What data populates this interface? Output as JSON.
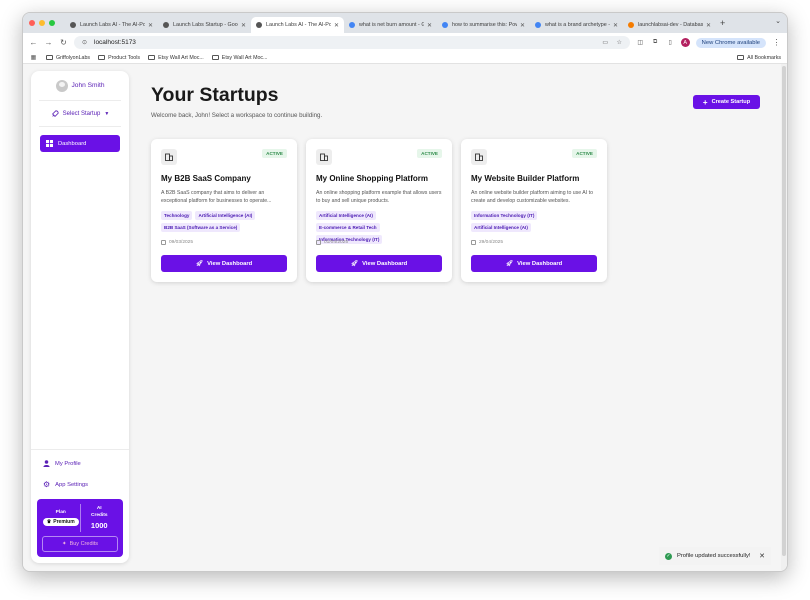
{
  "browser": {
    "tabs": [
      {
        "label": "Launch Labs AI - The AI-Pow",
        "fav_color": "#555555",
        "active": false
      },
      {
        "label": "Launch Labs Startup - Googl",
        "fav_color": "#555555",
        "active": false
      },
      {
        "label": "Launch Labs AI - The AI-Pow",
        "fav_color": "#555555",
        "active": true
      },
      {
        "label": "what is net burn amount - Go",
        "fav_color": "#4285f4",
        "active": false
      },
      {
        "label": "how to summarise this: Powe",
        "fav_color": "#4285f4",
        "active": false
      },
      {
        "label": "what is a brand archetype - G",
        "fav_color": "#4285f4",
        "active": false
      },
      {
        "label": "launchlabsai-dev - Database",
        "fav_color": "#f57c00",
        "active": false
      }
    ],
    "url": "localhost:5173",
    "new_chrome_label": "New Chrome available",
    "profile_initial": "A",
    "bookmarks": [
      "GriffolyonLabs",
      "Product Tools",
      "Etsy Wall Art Moc...",
      "Etsy Wall Art Moc..."
    ],
    "all_bookmarks_label": "All Bookmarks"
  },
  "sidebar": {
    "user_name": "John Smith",
    "select_startup_label": "Select Startup",
    "dashboard_label": "Dashboard",
    "my_profile_label": "My Profile",
    "app_settings_label": "App Settings",
    "plan_label": "Plan",
    "plan_value": "Premium",
    "credits_label_1": "AI",
    "credits_label_2": "Credits",
    "credits_value": "1000",
    "buy_credits_label": "Buy Credits"
  },
  "main": {
    "title": "Your Startups",
    "subtitle": "Welcome back, John! Select a workspace to continue building.",
    "create_button_label": "Create Startup",
    "cards": [
      {
        "status": "ACTIVE",
        "title": "My B2B SaaS Company",
        "description": "A B2B SaaS company that aims to deliver an exceptional platform for businesses to operate...",
        "tags": [
          "Technology",
          "Artificial Intelligence (AI)",
          "B2B SaaS (Software as a Service)"
        ],
        "date": "09/03/2025",
        "button_label": "View Dashboard"
      },
      {
        "status": "ACTIVE",
        "title": "My Online Shopping Platform",
        "description": "An online shopping platform example that allows users to buy and sell unique products.",
        "tags": [
          "Artificial Intelligence (AI)",
          "E-commerce & Retail Tech",
          "Information Technology (IT)"
        ],
        "date": "01/04/2025",
        "button_label": "View Dashboard"
      },
      {
        "status": "ACTIVE",
        "title": "My Website Builder Platform",
        "description": "An online website builder platform aiming to use AI to create and develop customizable websites.",
        "tags": [
          "Information Technology (IT)",
          "Artificial Intelligence (AI)"
        ],
        "date": "29/04/2025",
        "button_label": "View Dashboard"
      }
    ]
  },
  "toast": {
    "message": "Profile updated successfully!"
  },
  "colors": {
    "accent": "#6a11e6",
    "success": "#2e9a52"
  }
}
